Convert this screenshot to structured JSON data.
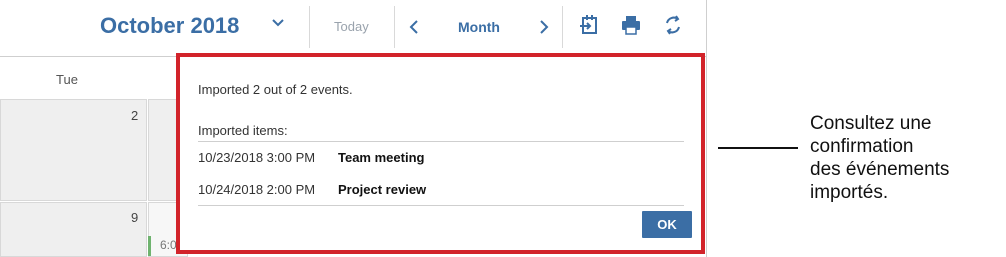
{
  "toolbar": {
    "month_title": "October 2018",
    "today_label": "Today",
    "view_label": "Month",
    "icons": [
      "chevron-down-icon",
      "chevron-left-icon",
      "chevron-right-icon",
      "import-icon",
      "print-icon",
      "refresh-icon"
    ],
    "accent_color": "#3b6ea5"
  },
  "calendar": {
    "day_header": "Tue",
    "cells": [
      {
        "date": "2"
      },
      {
        "date": "9"
      }
    ],
    "event_text": "6:0"
  },
  "dialog": {
    "summary": "Imported 2 out of 2 events.",
    "items_label": "Imported items:",
    "items": [
      {
        "datetime": "10/23/2018 3:00 PM",
        "name": "Team meeting"
      },
      {
        "datetime": "10/24/2018 2:00 PM",
        "name": "Project review"
      }
    ],
    "ok_label": "OK",
    "highlight_color": "#d2232a"
  },
  "callout": {
    "lines": [
      "Consultez une",
      "confirmation",
      "des événements",
      "importés."
    ]
  }
}
